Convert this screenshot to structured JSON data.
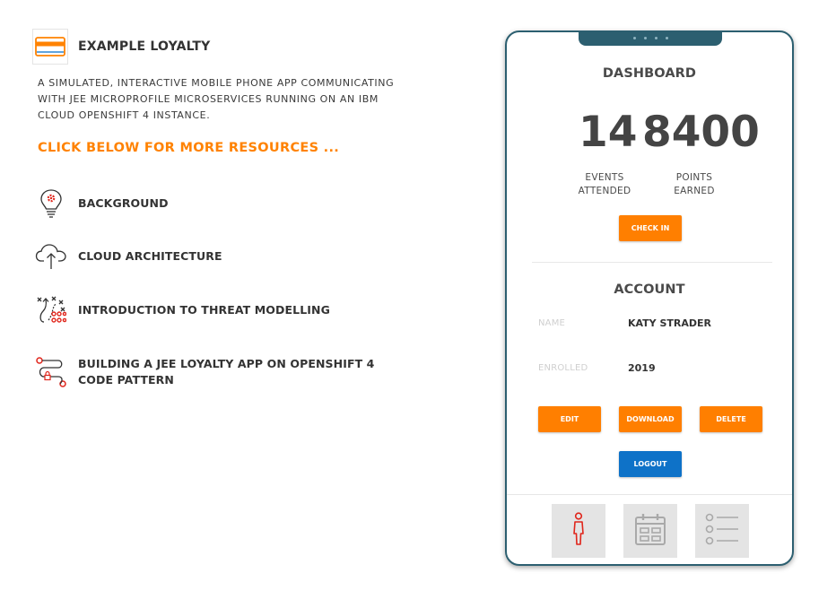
{
  "brand": {
    "title": "EXAMPLE LOYALTY",
    "logo_icon": "card-icon"
  },
  "intro": {
    "line1": "A SIMULATED, INTERACTIVE MOBILE PHONE APP COMMUNICATING",
    "line2": "WITH JEE MICROPROFILE MICROSERVICES RUNNING ON AN IBM",
    "line3": "CLOUD OPENSHIFT 4 INSTANCE."
  },
  "cta": "CLICK BELOW FOR MORE RESOURCES ...",
  "resources": [
    {
      "label": "BACKGROUND",
      "icon": "lightbulb-gear-icon"
    },
    {
      "label": "CLOUD ARCHITECTURE",
      "icon": "cloud-upload-icon"
    },
    {
      "label": "INTRODUCTION TO THREAT MODELLING",
      "icon": "strategy-play-icon"
    },
    {
      "label": "BUILDING A JEE LOYALTY APP ON OPENSHIFT 4 CODE PATTERN",
      "icon": "route-pattern-icon"
    }
  ],
  "phone": {
    "dashboard": {
      "title": "DASHBOARD",
      "events_value": "14",
      "points_value": "8400",
      "events_label_1": "EVENTS",
      "events_label_2": "ATTENDED",
      "points_label_1": "POINTS",
      "points_label_2": "EARNED",
      "checkin_label": "CHECK IN"
    },
    "account": {
      "title": "ACCOUNT",
      "name_label": "NAME",
      "name_value": "KATY STRADER",
      "enrolled_label": "ENROLLED",
      "enrolled_value": "2019",
      "edit_label": "EDIT",
      "download_label": "DOWNLOAD",
      "delete_label": "DELETE",
      "logout_label": "LOGOUT"
    },
    "tabs": [
      {
        "icon": "person-icon",
        "active": true
      },
      {
        "icon": "calendar-icon",
        "active": false
      },
      {
        "icon": "list-icon",
        "active": false
      }
    ]
  },
  "colors": {
    "accent_orange": "#ff7f00",
    "logout_blue": "#0e72c8",
    "phone_frame": "#2c5f70",
    "active_tab_icon": "#e0251b"
  }
}
